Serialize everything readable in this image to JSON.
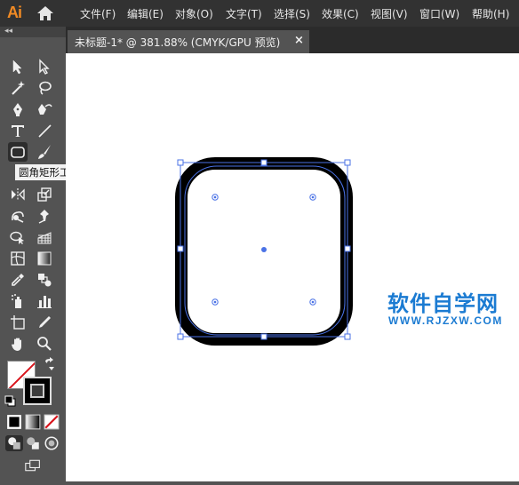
{
  "app": {
    "logo": "Ai",
    "menu": [
      "文件(F)",
      "编辑(E)",
      "对象(O)",
      "文字(T)",
      "选择(S)",
      "效果(C)",
      "视图(V)",
      "窗口(W)",
      "帮助(H)"
    ]
  },
  "panel": {
    "collapse_label": "◂◂"
  },
  "document_tab": {
    "title": "未标题-1* @ 381.88% (CMYK/GPU 预览)",
    "close_label": "×"
  },
  "tooltip": {
    "text": "圆角矩形工具"
  },
  "watermark": {
    "text": "软件自学网",
    "url": "WWW.RJZXW.COM",
    "color": "#1b7bd2"
  },
  "colors": {
    "menubar_bg": "#323232",
    "panel_bg": "#535353",
    "selection": "#4a72e6",
    "logo": "#f08a24"
  },
  "tools": [
    "selection-tool-icon",
    "direct-selection-tool-icon",
    "magic-wand-tool-icon",
    "lasso-tool-icon",
    "pen-tool-icon",
    "curvature-tool-icon",
    "type-tool-icon",
    "line-segment-tool-icon",
    "rounded-rectangle-tool-icon",
    "paintbrush-tool-icon",
    "reflect-tool-icon",
    "scale-tool-icon",
    "warp-tool-icon",
    "puppet-warp-tool-icon",
    "shape-builder-tool-icon",
    "perspective-grid-tool-icon",
    "mesh-tool-icon",
    "gradient-tool-icon",
    "eyedropper-tool-icon",
    "blend-tool-icon",
    "symbol-sprayer-tool-icon",
    "column-graph-tool-icon",
    "artboard-tool-icon",
    "slice-tool-icon",
    "hand-tool-icon",
    "zoom-tool-icon"
  ]
}
